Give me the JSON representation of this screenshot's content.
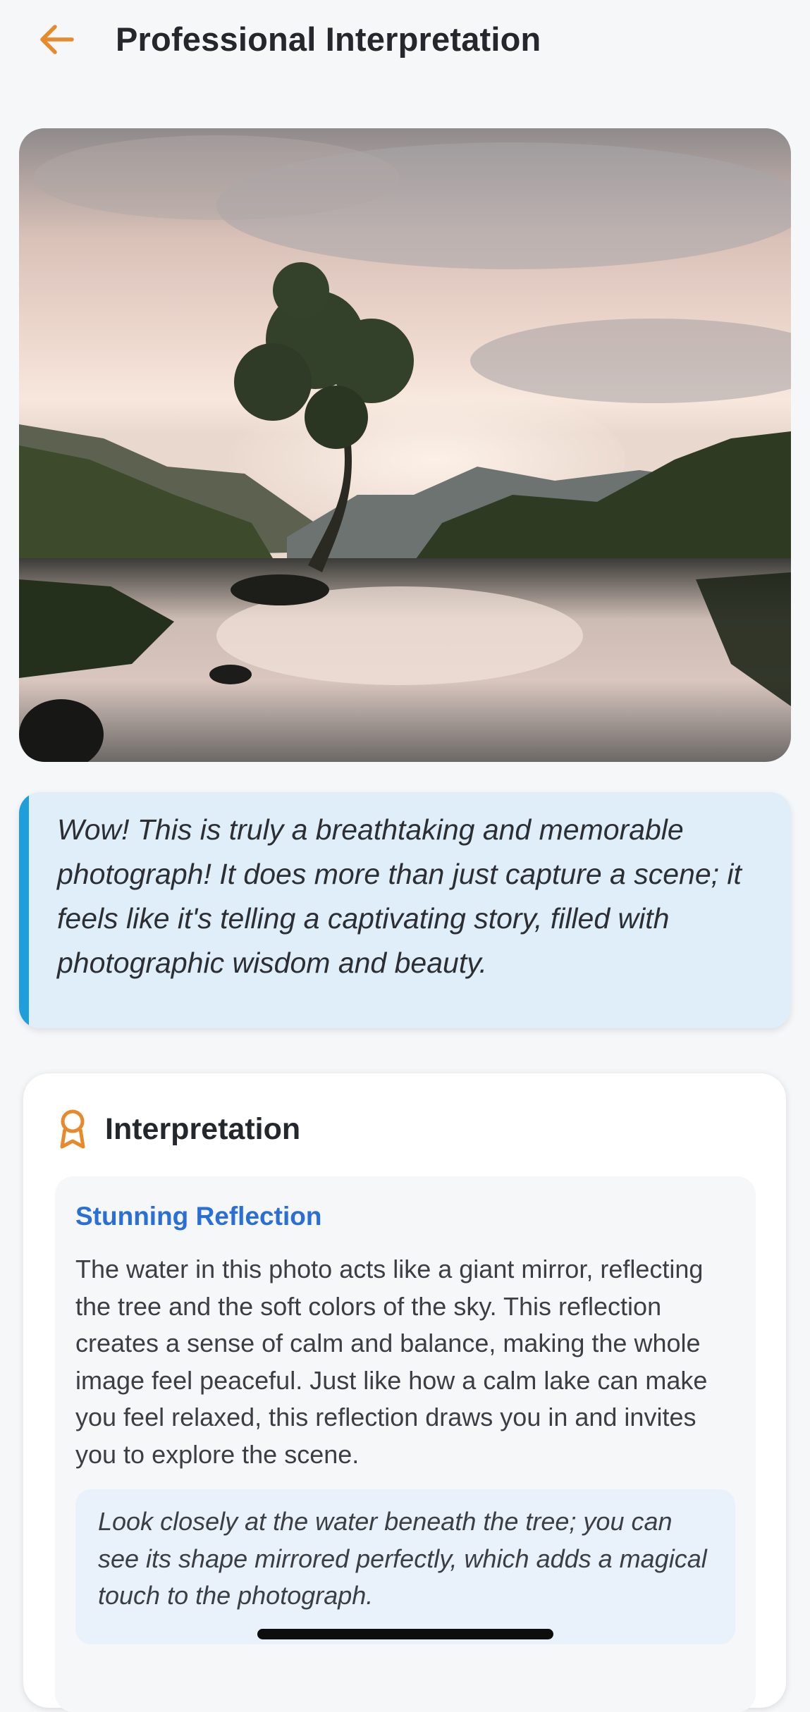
{
  "header": {
    "back_icon": "arrow-left-icon",
    "title": "Professional Interpretation",
    "accent": "#e8892b"
  },
  "photo": {
    "subject": "Lone tree on a lake at dusk with mountains and reflection"
  },
  "quote": {
    "text": "Wow! This is truly a breathtaking and memorable photograph! It does more than just capture a scene; it feels like it's telling a captivating story, filled with photographic wisdom and beauty.",
    "accent": "#1e9fdc"
  },
  "interpretation": {
    "heading": "Interpretation",
    "icon": "award-ribbon-icon",
    "section": {
      "title": "Stunning Reflection",
      "body": "The water in this photo acts like a giant mirror, reflecting the tree and the soft colors of the sky. This reflection creates a sense of calm and balance, making the whole image feel peaceful. Just like how a calm lake can make you feel relaxed, this reflection draws you in and invites you to explore the scene.",
      "tip": "Look closely at the water beneath the tree; you can see its shape mirrored perfectly, which adds a magical touch to the photograph."
    }
  }
}
